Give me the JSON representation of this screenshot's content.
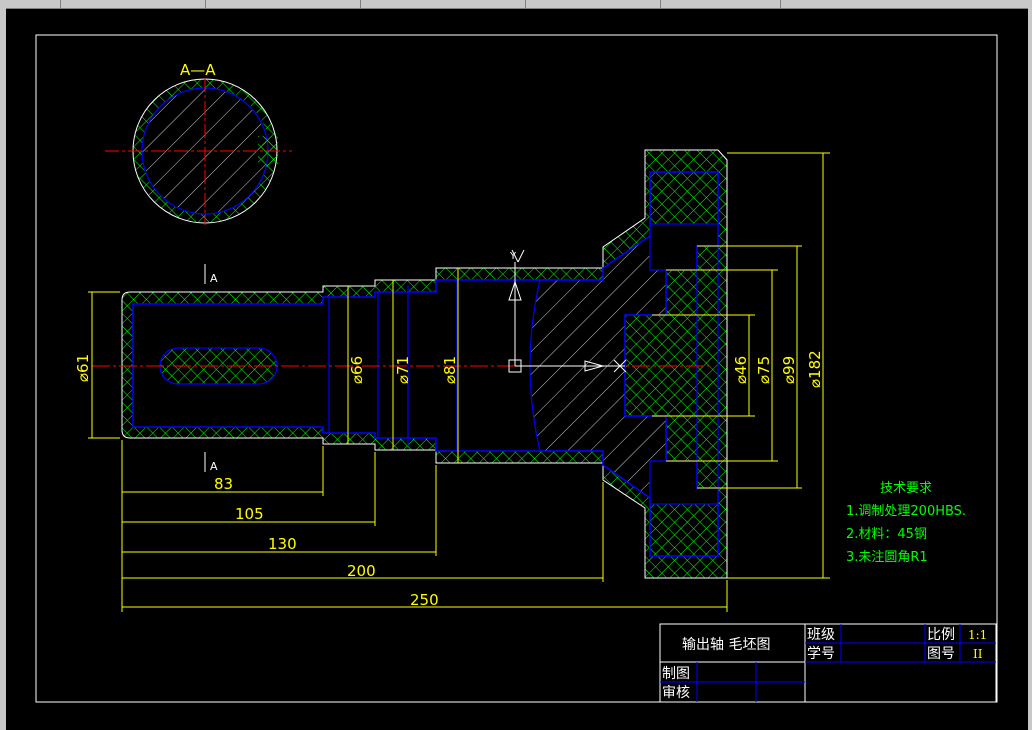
{
  "section_label": "A—A",
  "cut_marks": [
    "A",
    "A"
  ],
  "axis_label": "Y",
  "diameters": [
    "⌀61",
    "⌀66",
    "⌀71",
    "⌀81",
    "⌀46",
    "⌀75",
    "⌀99",
    "⌀182"
  ],
  "lengths": [
    "83",
    "105",
    "130",
    "200",
    "250"
  ],
  "tech": {
    "title": "技术要求",
    "items": [
      "1.调制处理200HBS.",
      "2.材料：45钢",
      "3.未注圆角R1"
    ]
  },
  "title_block": {
    "part_name": "输出轴 毛坯图",
    "class_label": "班级",
    "student_id_label": "学号",
    "scale_label": "比例",
    "scale_value": "1:1",
    "drawing_no_label": "图号",
    "drawing_no_value": "II",
    "drawn_label": "制图",
    "check_label": "审核"
  },
  "colors": {
    "background": "#000000",
    "outline": "#0000ff",
    "centerline": "#ff0000",
    "dimension": "#ffff00",
    "hatch": "#ffffff",
    "allowance": "#00ff00"
  }
}
